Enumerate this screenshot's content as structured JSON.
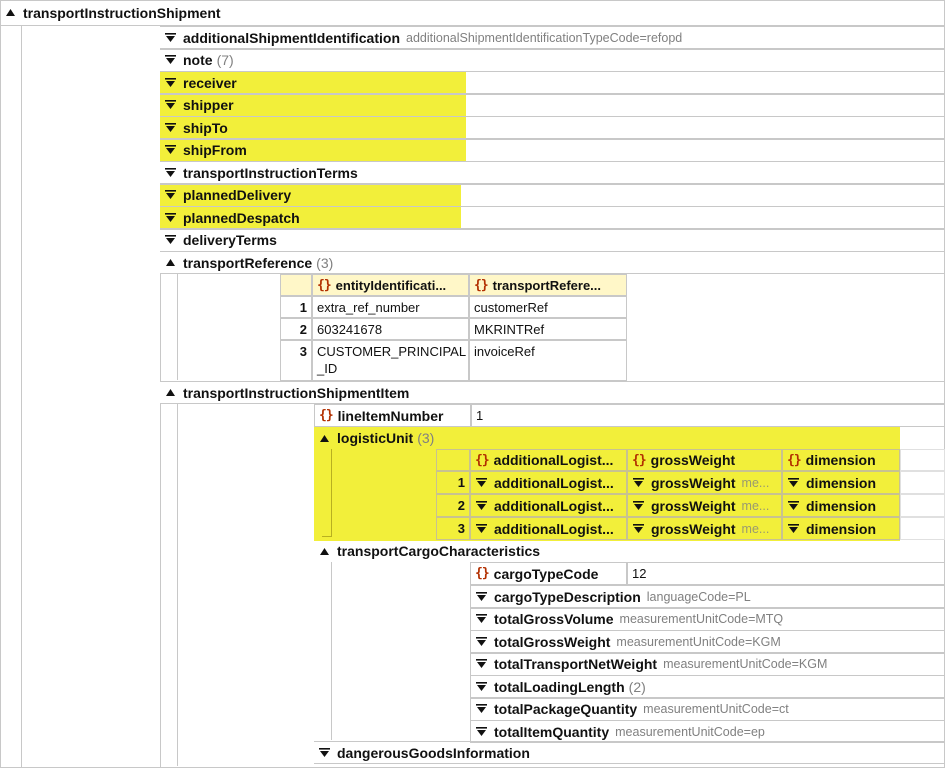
{
  "root": {
    "label": "transportInstructionShipment"
  },
  "top_nodes": [
    {
      "label": "additionalShipmentIdentification",
      "attr": "additionalShipmentIdentificationTypeCode=refopd",
      "count": ""
    },
    {
      "label": "note",
      "attr": "",
      "count": "(7)"
    },
    {
      "label": "receiver",
      "attr": "",
      "count": ""
    },
    {
      "label": "shipper",
      "attr": "",
      "count": ""
    },
    {
      "label": "shipTo",
      "attr": "",
      "count": ""
    },
    {
      "label": "shipFrom",
      "attr": "",
      "count": ""
    },
    {
      "label": "transportInstructionTerms",
      "attr": "",
      "count": ""
    },
    {
      "label": "plannedDelivery",
      "attr": "",
      "count": ""
    },
    {
      "label": "plannedDespatch",
      "attr": "",
      "count": ""
    },
    {
      "label": "deliveryTerms",
      "attr": "",
      "count": ""
    }
  ],
  "transport_reference": {
    "label": "transportReference",
    "count": "(3)",
    "columns": [
      "entityIdentificati...",
      "transportRefere..."
    ],
    "rows": [
      {
        "n": "1",
        "a": "extra_ref_number",
        "b": "customerRef"
      },
      {
        "n": "2",
        "a": "603241678",
        "b": "MKRINTRef"
      },
      {
        "n": "3",
        "a": "CUSTOMER_PRINCIPAL",
        "a2": "_ID",
        "b": "invoiceRef"
      }
    ]
  },
  "shipment_item": {
    "label": "transportInstructionShipmentItem",
    "line_item_label": "lineItemNumber",
    "line_item_value": "1",
    "logistic_unit": {
      "label": "logisticUnit",
      "count": "(3)",
      "columns": [
        "additionalLogist...",
        "grossWeight",
        "dimension"
      ],
      "row_attr": "me...",
      "rows": [
        "1",
        "2",
        "3"
      ]
    },
    "cargo": {
      "label": "transportCargoCharacteristics",
      "cargo_type_code_label": "cargoTypeCode",
      "cargo_type_code_value": "12",
      "items": [
        {
          "label": "cargoTypeDescription",
          "attr": "languageCode=PL",
          "count": ""
        },
        {
          "label": "totalGrossVolume",
          "attr": "measurementUnitCode=MTQ",
          "count": ""
        },
        {
          "label": "totalGrossWeight",
          "attr": "measurementUnitCode=KGM",
          "count": ""
        },
        {
          "label": "totalTransportNetWeight",
          "attr": "measurementUnitCode=KGM",
          "count": ""
        },
        {
          "label": "totalLoadingLength",
          "attr": "",
          "count": "(2)"
        },
        {
          "label": "totalPackageQuantity",
          "attr": "measurementUnitCode=ct",
          "count": ""
        },
        {
          "label": "totalItemQuantity",
          "attr": "measurementUnitCode=ep",
          "count": ""
        }
      ]
    },
    "dangerous_goods_label": "dangerousGoodsInformation"
  },
  "colors": {
    "highlight": "#f2ef3a",
    "brace": "#b22f00",
    "header_bg": "#fff7c8",
    "border": "#c8c8c8"
  }
}
